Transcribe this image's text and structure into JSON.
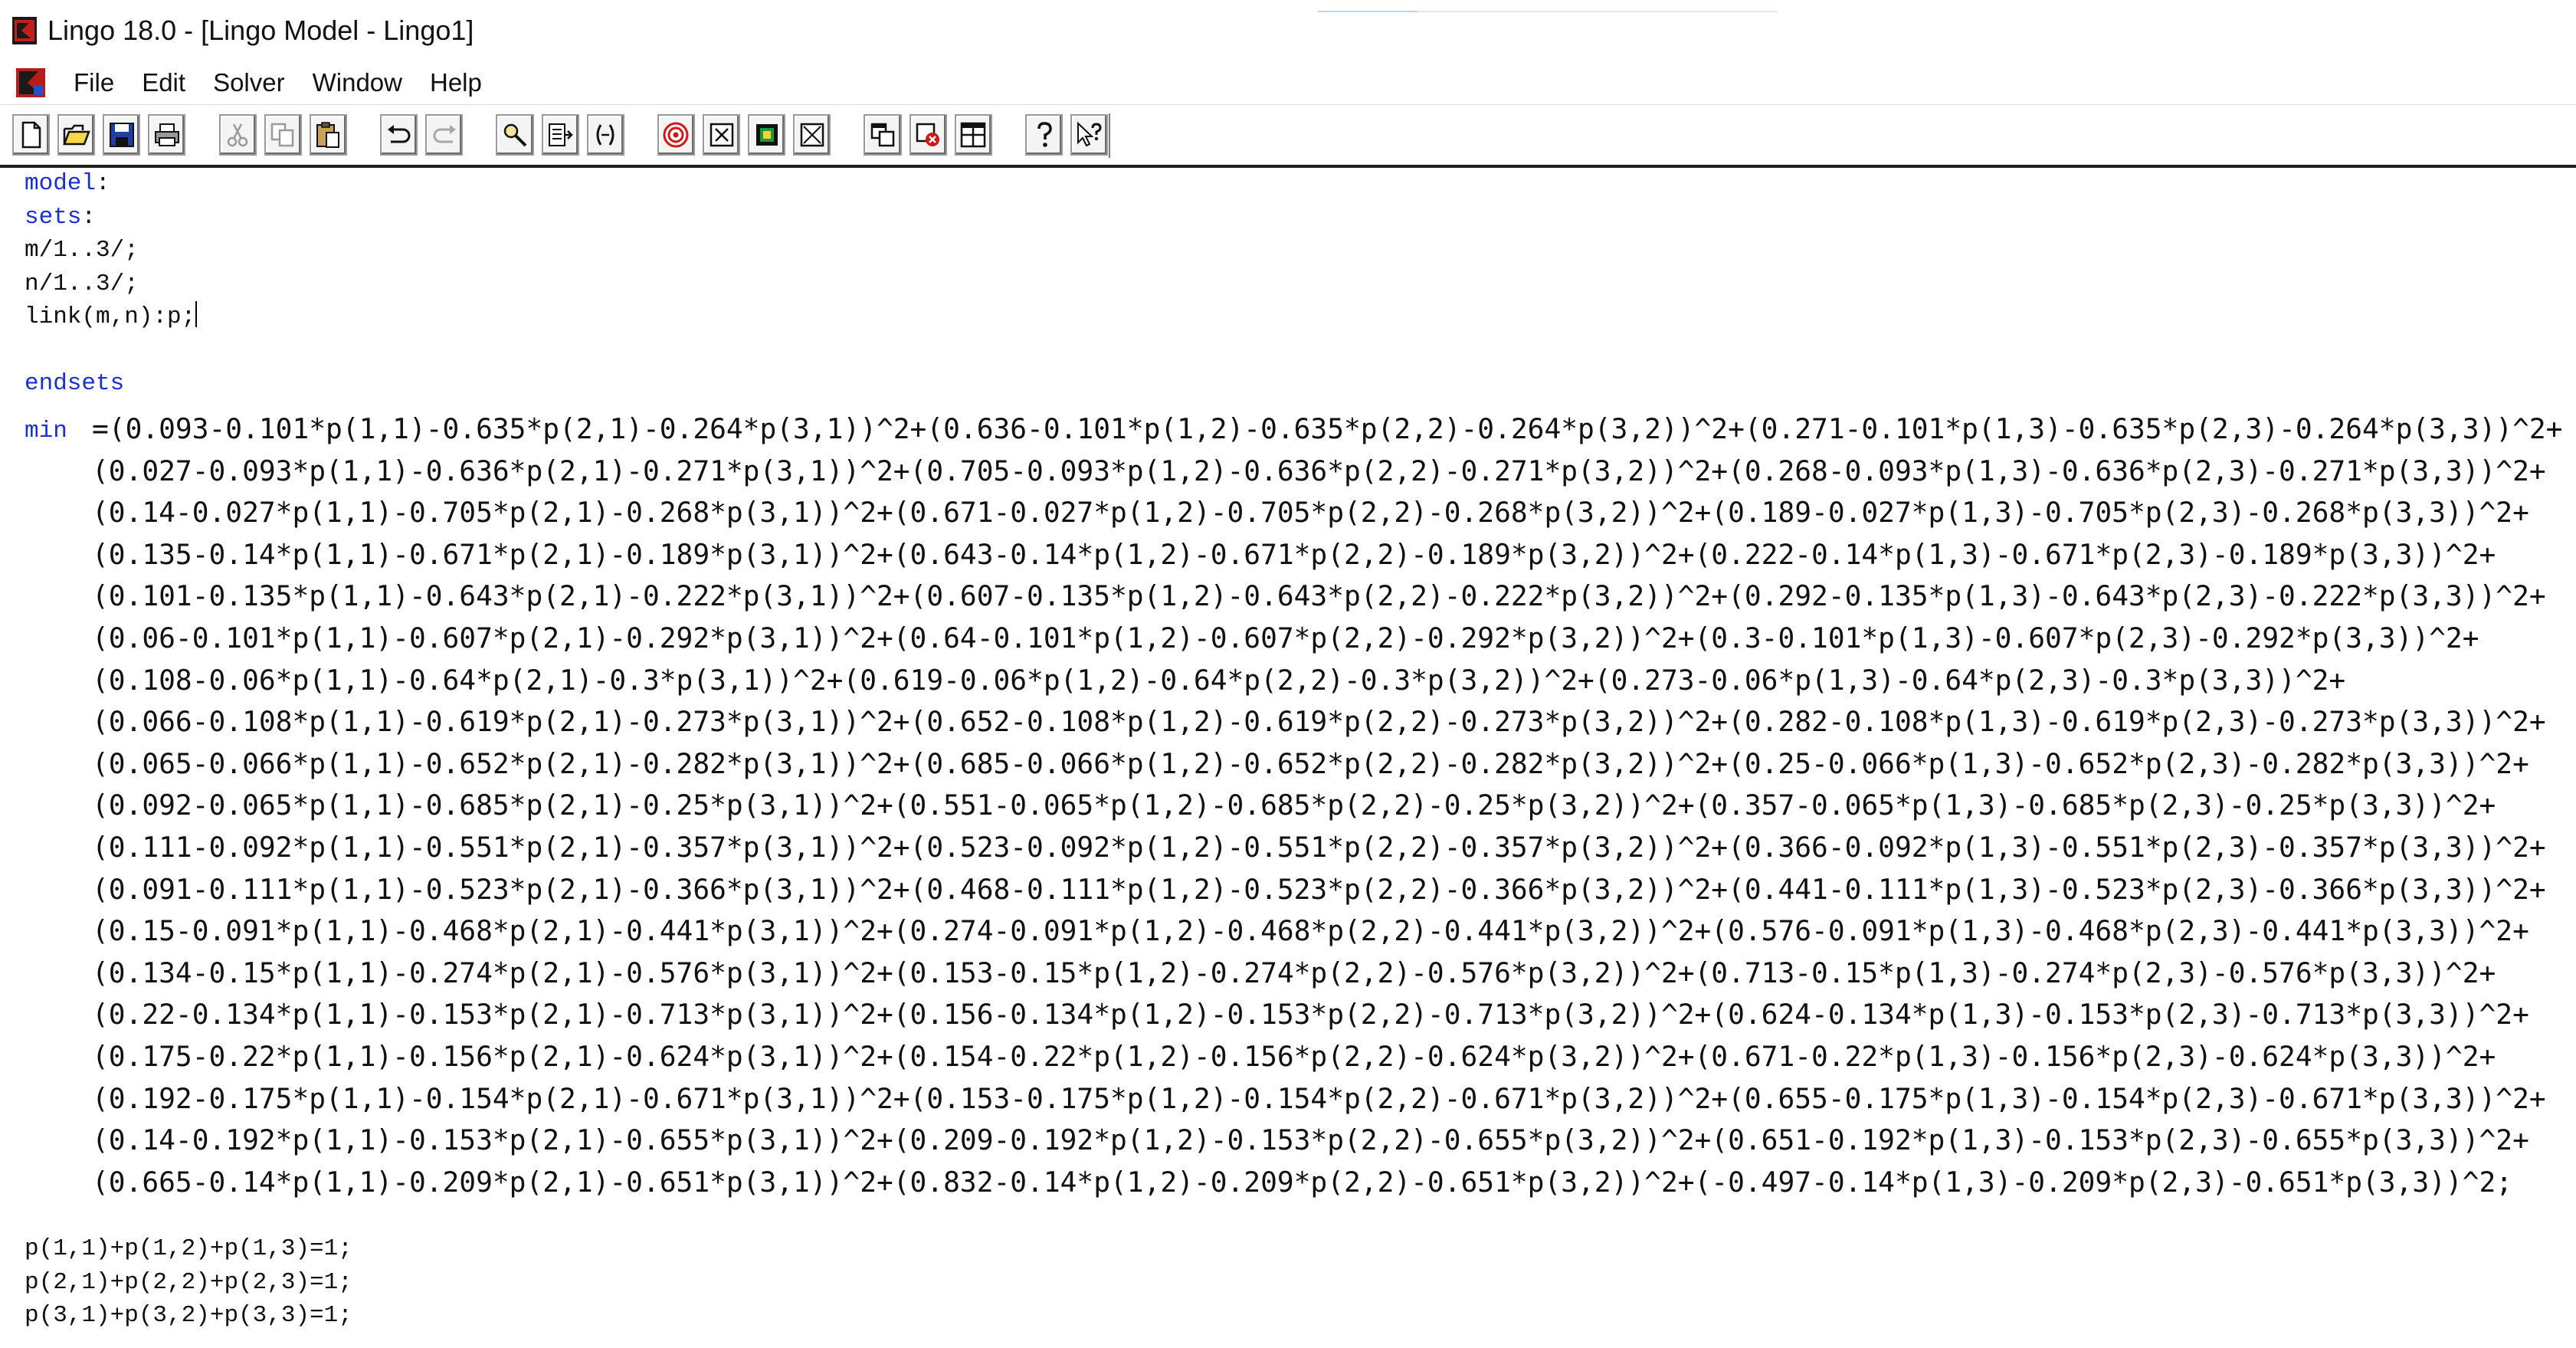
{
  "window": {
    "title": "Lingo 18.0 - [Lingo Model - Lingo1]"
  },
  "menu": {
    "items": [
      "File",
      "Edit",
      "Solver",
      "Window",
      "Help"
    ]
  },
  "toolbar": {
    "buttons": [
      "new-file-icon",
      "open-folder-icon",
      "save-icon",
      "print-icon",
      "cut-icon",
      "copy-icon",
      "paste-icon",
      "undo-icon",
      "redo-icon",
      "find-icon",
      "goto-line-icon",
      "match-parenthesis-icon",
      "solve-icon",
      "solution-icon",
      "matrix-picture-icon",
      "close-all-icon",
      "send-to-back-icon",
      "close-icon",
      "tile-icon",
      "help-icon",
      "help-pointer-icon"
    ]
  },
  "editor": {
    "lines_top": [
      {
        "kw": "model",
        "rest": ":"
      },
      {
        "kw": "sets",
        "rest": ":"
      },
      {
        "kw": "",
        "rest": "m/1..3/;"
      },
      {
        "kw": "",
        "rest": "n/1..3/;"
      },
      {
        "kw": "",
        "rest": "link(m,n):p;"
      },
      {
        "kw": "",
        "rest": ""
      },
      {
        "kw": "endsets",
        "rest": ""
      }
    ],
    "min_keyword": "min",
    "objective_lines": [
      "=(0.093-0.101*p(1,1)-0.635*p(2,1)-0.264*p(3,1))^2+(0.636-0.101*p(1,2)-0.635*p(2,2)-0.264*p(3,2))^2+(0.271-0.101*p(1,3)-0.635*p(2,3)-0.264*p(3,3))^2+",
      "(0.027-0.093*p(1,1)-0.636*p(2,1)-0.271*p(3,1))^2+(0.705-0.093*p(1,2)-0.636*p(2,2)-0.271*p(3,2))^2+(0.268-0.093*p(1,3)-0.636*p(2,3)-0.271*p(3,3))^2+",
      "(0.14-0.027*p(1,1)-0.705*p(2,1)-0.268*p(3,1))^2+(0.671-0.027*p(1,2)-0.705*p(2,2)-0.268*p(3,2))^2+(0.189-0.027*p(1,3)-0.705*p(2,3)-0.268*p(3,3))^2+",
      "(0.135-0.14*p(1,1)-0.671*p(2,1)-0.189*p(3,1))^2+(0.643-0.14*p(1,2)-0.671*p(2,2)-0.189*p(3,2))^2+(0.222-0.14*p(1,3)-0.671*p(2,3)-0.189*p(3,3))^2+",
      "(0.101-0.135*p(1,1)-0.643*p(2,1)-0.222*p(3,1))^2+(0.607-0.135*p(1,2)-0.643*p(2,2)-0.222*p(3,2))^2+(0.292-0.135*p(1,3)-0.643*p(2,3)-0.222*p(3,3))^2+",
      "(0.06-0.101*p(1,1)-0.607*p(2,1)-0.292*p(3,1))^2+(0.64-0.101*p(1,2)-0.607*p(2,2)-0.292*p(3,2))^2+(0.3-0.101*p(1,3)-0.607*p(2,3)-0.292*p(3,3))^2+",
      "(0.108-0.06*p(1,1)-0.64*p(2,1)-0.3*p(3,1))^2+(0.619-0.06*p(1,2)-0.64*p(2,2)-0.3*p(3,2))^2+(0.273-0.06*p(1,3)-0.64*p(2,3)-0.3*p(3,3))^2+",
      "(0.066-0.108*p(1,1)-0.619*p(2,1)-0.273*p(3,1))^2+(0.652-0.108*p(1,2)-0.619*p(2,2)-0.273*p(3,2))^2+(0.282-0.108*p(1,3)-0.619*p(2,3)-0.273*p(3,3))^2+",
      "(0.065-0.066*p(1,1)-0.652*p(2,1)-0.282*p(3,1))^2+(0.685-0.066*p(1,2)-0.652*p(2,2)-0.282*p(3,2))^2+(0.25-0.066*p(1,3)-0.652*p(2,3)-0.282*p(3,3))^2+",
      "(0.092-0.065*p(1,1)-0.685*p(2,1)-0.25*p(3,1))^2+(0.551-0.065*p(1,2)-0.685*p(2,2)-0.25*p(3,2))^2+(0.357-0.065*p(1,3)-0.685*p(2,3)-0.25*p(3,3))^2+",
      "(0.111-0.092*p(1,1)-0.551*p(2,1)-0.357*p(3,1))^2+(0.523-0.092*p(1,2)-0.551*p(2,2)-0.357*p(3,2))^2+(0.366-0.092*p(1,3)-0.551*p(2,3)-0.357*p(3,3))^2+",
      "(0.091-0.111*p(1,1)-0.523*p(2,1)-0.366*p(3,1))^2+(0.468-0.111*p(1,2)-0.523*p(2,2)-0.366*p(3,2))^2+(0.441-0.111*p(1,3)-0.523*p(2,3)-0.366*p(3,3))^2+",
      "(0.15-0.091*p(1,1)-0.468*p(2,1)-0.441*p(3,1))^2+(0.274-0.091*p(1,2)-0.468*p(2,2)-0.441*p(3,2))^2+(0.576-0.091*p(1,3)-0.468*p(2,3)-0.441*p(3,3))^2+",
      "(0.134-0.15*p(1,1)-0.274*p(2,1)-0.576*p(3,1))^2+(0.153-0.15*p(1,2)-0.274*p(2,2)-0.576*p(3,2))^2+(0.713-0.15*p(1,3)-0.274*p(2,3)-0.576*p(3,3))^2+",
      "(0.22-0.134*p(1,1)-0.153*p(2,1)-0.713*p(3,1))^2+(0.156-0.134*p(1,2)-0.153*p(2,2)-0.713*p(3,2))^2+(0.624-0.134*p(1,3)-0.153*p(2,3)-0.713*p(3,3))^2+",
      "(0.175-0.22*p(1,1)-0.156*p(2,1)-0.624*p(3,1))^2+(0.154-0.22*p(1,2)-0.156*p(2,2)-0.624*p(3,2))^2+(0.671-0.22*p(1,3)-0.156*p(2,3)-0.624*p(3,3))^2+",
      "(0.192-0.175*p(1,1)-0.154*p(2,1)-0.671*p(3,1))^2+(0.153-0.175*p(1,2)-0.154*p(2,2)-0.671*p(3,2))^2+(0.655-0.175*p(1,3)-0.154*p(2,3)-0.671*p(3,3))^2+",
      "(0.14-0.192*p(1,1)-0.153*p(2,1)-0.655*p(3,1))^2+(0.209-0.192*p(1,2)-0.153*p(2,2)-0.655*p(3,2))^2+(0.651-0.192*p(1,3)-0.153*p(2,3)-0.655*p(3,3))^2+",
      "(0.665-0.14*p(1,1)-0.209*p(2,1)-0.651*p(3,1))^2+(0.832-0.14*p(1,2)-0.209*p(2,2)-0.651*p(3,2))^2+(-0.497-0.14*p(1,3)-0.209*p(2,3)-0.651*p(3,3))^2;"
    ],
    "constraints": [
      "p(1,1)+p(1,2)+p(1,3)=1;",
      "p(2,1)+p(2,2)+p(2,3)=1;",
      "p(3,1)+p(3,2)+p(3,3)=1;"
    ]
  },
  "colors": {
    "keyword": "#1b2fd6",
    "text": "#111111"
  }
}
